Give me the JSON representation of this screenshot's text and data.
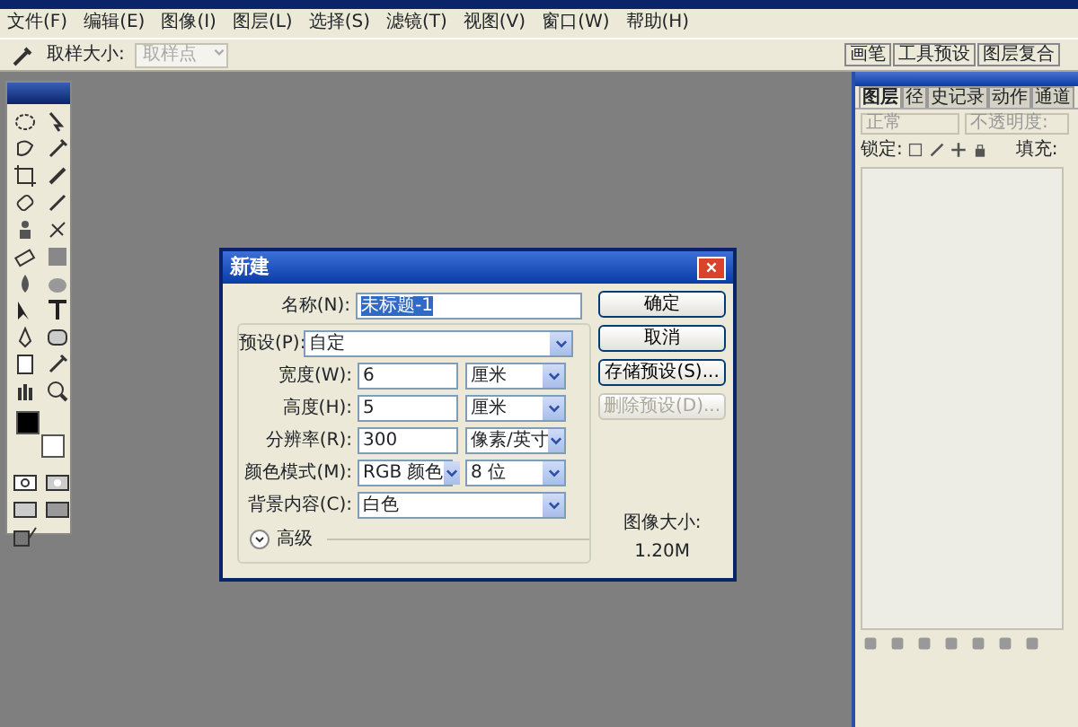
{
  "menu_bar": [
    {
      "label": "文件(F)"
    },
    {
      "label": "编辑(E)"
    },
    {
      "label": "图像(I)"
    },
    {
      "label": "图层(L)"
    },
    {
      "label": "选择(S)"
    },
    {
      "label": "滤镜(T)"
    },
    {
      "label": "视图(V)"
    },
    {
      "label": "窗口(W)"
    },
    {
      "label": "帮助(H)"
    }
  ],
  "options_bar": {
    "label": "取样大小:",
    "sample_select": "取样点"
  },
  "palette_well": {
    "tabs": [
      "画笔",
      "工具预设",
      "图层复合"
    ]
  },
  "dialog": {
    "title": "新建",
    "name": {
      "label": "名称(N):",
      "value": "未标题-1"
    },
    "preset": {
      "label": "预设(P):",
      "value": "自定"
    },
    "rows": [
      {
        "kind": "field",
        "label": "宽度(W):",
        "value": "6",
        "unit": "厘米"
      },
      {
        "kind": "field",
        "label": "高度(H):",
        "value": "5",
        "unit": "厘米"
      },
      {
        "kind": "field",
        "label": "分辨率(R):",
        "value": "300",
        "unit": "像素/英寸"
      },
      {
        "kind": "select",
        "label": "颜色模式(M):",
        "value": "RGB 颜色",
        "unit": "8 位"
      },
      {
        "kind": "wide",
        "label": "背景内容(C):",
        "value": "白色"
      }
    ],
    "advanced": {
      "label": "高级",
      "expanded": false
    },
    "buttons": [
      {
        "label": "确定",
        "disabled": false
      },
      {
        "label": "取消",
        "disabled": false
      },
      {
        "label": "存储预设(S)...",
        "disabled": false
      },
      {
        "label": "删除预设(D)...",
        "disabled": true
      }
    ],
    "image_size": {
      "label": "图像大小:",
      "value": "1.20M"
    }
  },
  "layers_panel": {
    "tabs": [
      {
        "label": "图层",
        "selected": true
      },
      {
        "label": "径",
        "selected": false
      },
      {
        "label": "史记录",
        "selected": false
      },
      {
        "label": "动作",
        "selected": false
      },
      {
        "label": "通道",
        "selected": false
      }
    ],
    "blend_mode": "正常",
    "opacity_label": "不透明度:",
    "lock_label": "锁定:",
    "fill_label": "填充:"
  }
}
